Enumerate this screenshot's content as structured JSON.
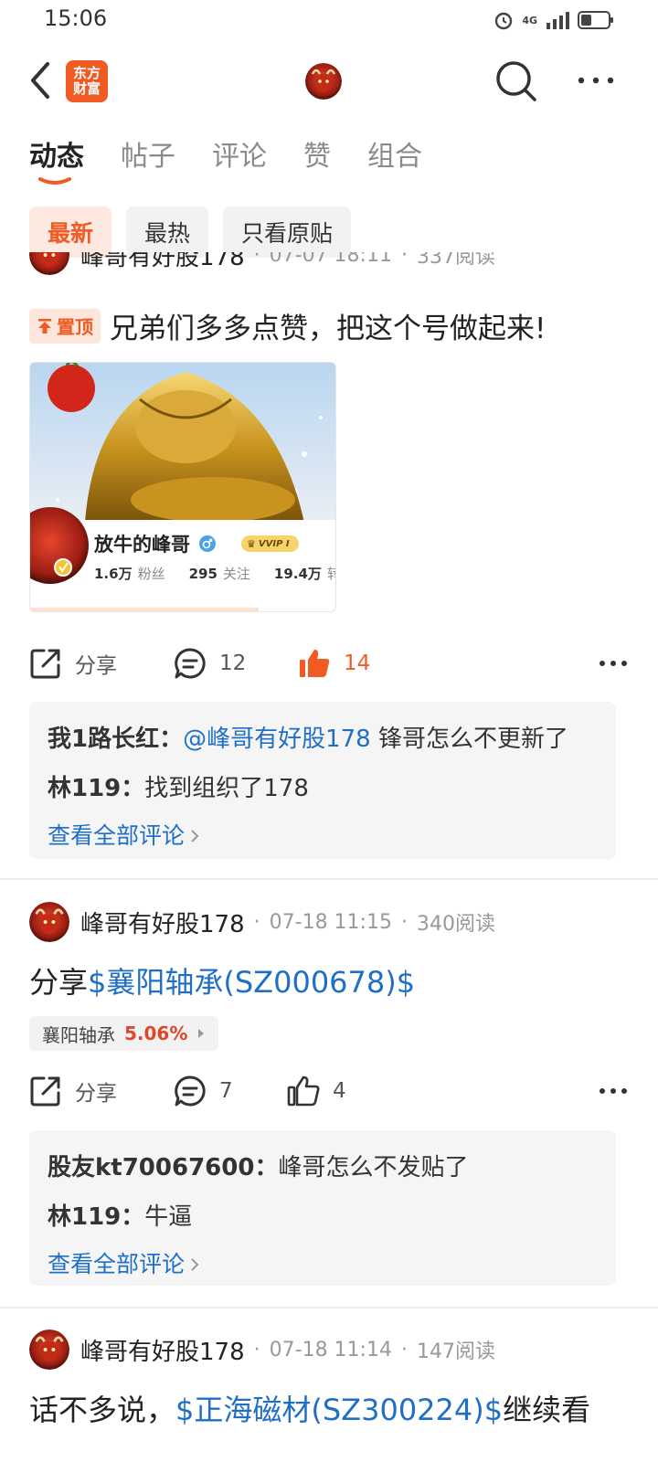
{
  "status_bar": {
    "time": "15:06",
    "network": "4G",
    "battery": "40%"
  },
  "header": {
    "logo_line1": "东方",
    "logo_line2": "财富"
  },
  "tabs": [
    {
      "label": "动态",
      "active": true
    },
    {
      "label": "帖子",
      "active": false
    },
    {
      "label": "评论",
      "active": false
    },
    {
      "label": "赞",
      "active": false
    },
    {
      "label": "组合",
      "active": false
    }
  ],
  "filters": [
    {
      "label": "最新",
      "active": true
    },
    {
      "label": "最热",
      "active": false
    },
    {
      "label": "只看原贴",
      "active": false
    }
  ],
  "colors": {
    "accent": "#f15a22",
    "link": "#1f6fc6",
    "up": "#e0462a"
  },
  "posts": [
    {
      "author": "峰哥有好股178",
      "time": "07-07 18:11",
      "reads": "337阅读",
      "pinned_label": "置顶",
      "text": "兄弟们多多点赞，把这个号做起来!",
      "card": {
        "name": "放牛的峰哥",
        "vip": "VVIP I",
        "fans_num": "1.6万",
        "fans_label": "粉丝",
        "follow_num": "295",
        "follow_label": "关注",
        "third_num": "19.4万",
        "third_label": "转"
      },
      "actions": {
        "share": "分享",
        "comments": "12",
        "likes": "14"
      },
      "comments": [
        {
          "user": "我1路长红：",
          "mention": "@峰哥有好股178",
          "text": " 锋哥怎么不更新了"
        },
        {
          "user": "林119：",
          "mention": "",
          "text": "找到组织了178"
        }
      ],
      "view_all": "查看全部评论"
    },
    {
      "author": "峰哥有好股178",
      "time": "07-18 11:15",
      "reads": "340阅读",
      "text_prefix": "分享",
      "stock_link": "$襄阳轴承(SZ000678)$",
      "text_suffix": "",
      "stock_chip": {
        "name": "襄阳轴承",
        "change": "5.06%"
      },
      "actions": {
        "share": "分享",
        "comments": "7",
        "likes": "4"
      },
      "comments": [
        {
          "user": "股友kt70067600：",
          "mention": "",
          "text": "峰哥怎么不发贴了"
        },
        {
          "user": "林119：",
          "mention": "",
          "text": "牛逼"
        }
      ],
      "view_all": "查看全部评论"
    },
    {
      "author": "峰哥有好股178",
      "time": "07-18 11:14",
      "reads": "147阅读",
      "text_prefix": "话不多说，",
      "stock_link": "$正海磁材(SZ300224)$",
      "text_suffix": "继续看"
    }
  ],
  "separator": "·"
}
